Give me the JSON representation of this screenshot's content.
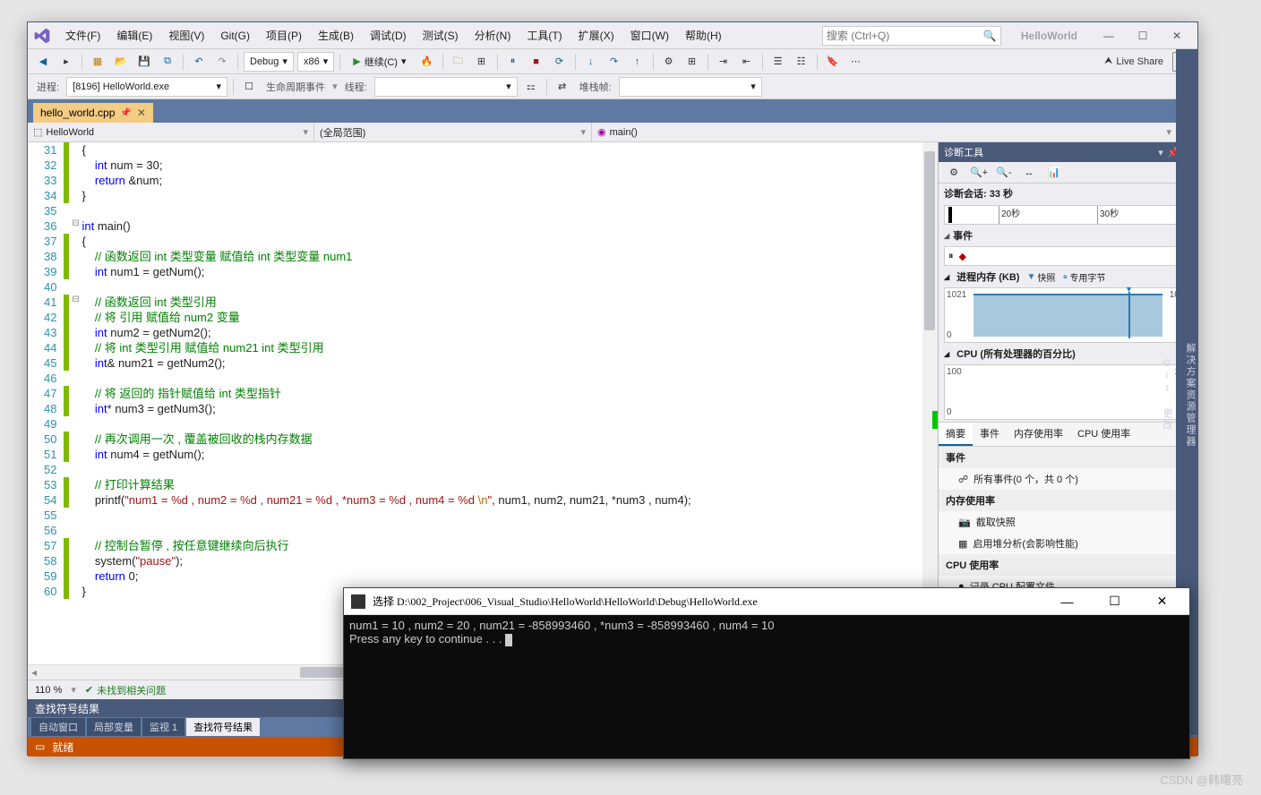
{
  "menu": {
    "items": [
      "文件(F)",
      "编辑(E)",
      "视图(V)",
      "Git(G)",
      "项目(P)",
      "生成(B)",
      "调试(D)",
      "测试(S)",
      "分析(N)",
      "工具(T)",
      "扩展(X)",
      "窗口(W)",
      "帮助(H)"
    ],
    "search_placeholder": "搜索 (Ctrl+Q)",
    "project": "HelloWorld"
  },
  "toolbar1": {
    "config": "Debug",
    "platform": "x86",
    "continue": "继续(C)",
    "live_share": "Live Share"
  },
  "toolbar2": {
    "process_label": "进程:",
    "process": "[8196] HelloWorld.exe",
    "lifecycle": "生命周期事件",
    "thread": "线程:",
    "stackframe": "堆栈帧:"
  },
  "tab": {
    "name": "hello_world.cpp"
  },
  "nav": {
    "project": "HelloWorld",
    "scope": "(全局范围)",
    "func": "main()"
  },
  "code": {
    "start_line": 31,
    "lines": [
      {
        "n": 31,
        "c": true,
        "f": "",
        "t": [
          {
            "c": "",
            "s": "{"
          }
        ]
      },
      {
        "n": 32,
        "c": true,
        "f": "",
        "t": [
          {
            "c": "",
            "s": "    "
          },
          {
            "c": "kw",
            "s": "int"
          },
          {
            "c": "",
            "s": " num = 30;"
          }
        ]
      },
      {
        "n": 33,
        "c": true,
        "f": "",
        "t": [
          {
            "c": "",
            "s": "    "
          },
          {
            "c": "kw",
            "s": "return"
          },
          {
            "c": "",
            "s": " &num;"
          }
        ]
      },
      {
        "n": 34,
        "c": true,
        "f": "",
        "t": [
          {
            "c": "",
            "s": "}"
          }
        ]
      },
      {
        "n": 35,
        "c": false,
        "f": "",
        "t": []
      },
      {
        "n": 36,
        "c": false,
        "f": "⊟",
        "t": [
          {
            "c": "kw",
            "s": "int"
          },
          {
            "c": "",
            "s": " main()"
          }
        ]
      },
      {
        "n": 37,
        "c": true,
        "f": "",
        "t": [
          {
            "c": "",
            "s": "{"
          }
        ]
      },
      {
        "n": 38,
        "c": true,
        "f": "",
        "t": [
          {
            "c": "",
            "s": "    "
          },
          {
            "c": "cm",
            "s": "// 函数返回 int 类型变量 赋值给 int 类型变量 num1"
          }
        ]
      },
      {
        "n": 39,
        "c": true,
        "f": "",
        "t": [
          {
            "c": "",
            "s": "    "
          },
          {
            "c": "kw",
            "s": "int"
          },
          {
            "c": "",
            "s": " num1 = getNum();"
          }
        ]
      },
      {
        "n": 40,
        "c": false,
        "f": "",
        "t": []
      },
      {
        "n": 41,
        "c": true,
        "f": "⊟",
        "t": [
          {
            "c": "",
            "s": "    "
          },
          {
            "c": "cm",
            "s": "// 函数返回 int 类型引用"
          }
        ]
      },
      {
        "n": 42,
        "c": true,
        "f": "",
        "t": [
          {
            "c": "",
            "s": "    "
          },
          {
            "c": "cm",
            "s": "// 将 引用 赋值给 num2 变量"
          }
        ]
      },
      {
        "n": 43,
        "c": true,
        "f": "",
        "t": [
          {
            "c": "",
            "s": "    "
          },
          {
            "c": "kw",
            "s": "int"
          },
          {
            "c": "",
            "s": " num2 = getNum2();"
          }
        ]
      },
      {
        "n": 44,
        "c": true,
        "f": "",
        "t": [
          {
            "c": "",
            "s": "    "
          },
          {
            "c": "cm",
            "s": "// 将 int 类型引用 赋值给 num21 int 类型引用"
          }
        ]
      },
      {
        "n": 45,
        "c": true,
        "f": "",
        "t": [
          {
            "c": "",
            "s": "    "
          },
          {
            "c": "kw",
            "s": "int"
          },
          {
            "c": "",
            "s": "& num21 = getNum2();"
          }
        ]
      },
      {
        "n": 46,
        "c": false,
        "f": "",
        "t": []
      },
      {
        "n": 47,
        "c": true,
        "f": "",
        "t": [
          {
            "c": "",
            "s": "    "
          },
          {
            "c": "cm",
            "s": "// 将 返回的 指针赋值给 int 类型指针"
          }
        ]
      },
      {
        "n": 48,
        "c": true,
        "f": "",
        "t": [
          {
            "c": "",
            "s": "    "
          },
          {
            "c": "kw",
            "s": "int"
          },
          {
            "c": "",
            "s": "* num3 = getNum3();"
          }
        ]
      },
      {
        "n": 49,
        "c": false,
        "f": "",
        "t": []
      },
      {
        "n": 50,
        "c": true,
        "f": "",
        "t": [
          {
            "c": "",
            "s": "    "
          },
          {
            "c": "cm",
            "s": "// 再次调用一次 , 覆盖被回收的栈内存数据"
          }
        ]
      },
      {
        "n": 51,
        "c": true,
        "f": "",
        "t": [
          {
            "c": "",
            "s": "    "
          },
          {
            "c": "kw",
            "s": "int"
          },
          {
            "c": "",
            "s": " num4 = getNum();"
          }
        ]
      },
      {
        "n": 52,
        "c": false,
        "f": "",
        "t": []
      },
      {
        "n": 53,
        "c": true,
        "f": "",
        "t": [
          {
            "c": "",
            "s": "    "
          },
          {
            "c": "cm",
            "s": "// 打印计算结果"
          }
        ]
      },
      {
        "n": 54,
        "c": true,
        "f": "",
        "t": [
          {
            "c": "",
            "s": "    printf("
          },
          {
            "c": "st",
            "s": "\"num1 = %d , num2 = %d , num21 = %d , *num3 = %d , num4 = %d "
          },
          {
            "c": "esc",
            "s": "\\n"
          },
          {
            "c": "st",
            "s": "\""
          },
          {
            "c": "",
            "s": ", num1, num2, num21, *num3 , num4);"
          }
        ]
      },
      {
        "n": 55,
        "c": false,
        "f": "",
        "t": []
      },
      {
        "n": 56,
        "c": false,
        "f": "",
        "t": []
      },
      {
        "n": 57,
        "c": true,
        "f": "",
        "t": [
          {
            "c": "",
            "s": "    "
          },
          {
            "c": "cm",
            "s": "// 控制台暂停 , 按任意键继续向后执行"
          }
        ]
      },
      {
        "n": 58,
        "c": true,
        "f": "",
        "t": [
          {
            "c": "",
            "s": "    system("
          },
          {
            "c": "st",
            "s": "\"pause\""
          },
          {
            "c": "",
            "s": ");"
          }
        ]
      },
      {
        "n": 59,
        "c": true,
        "f": "",
        "t": [
          {
            "c": "",
            "s": "    "
          },
          {
            "c": "kw",
            "s": "return"
          },
          {
            "c": "",
            "s": " 0;"
          }
        ]
      },
      {
        "n": 60,
        "c": true,
        "f": "",
        "t": [
          {
            "c": "",
            "s": "}"
          }
        ]
      }
    ]
  },
  "editor_status": {
    "zoom": "110 %",
    "issues": "未找到相关问题"
  },
  "diag": {
    "title": "诊断工具",
    "session": "诊断会话: 33 秒",
    "timeline": {
      "t1": "20秒",
      "t2": "30秒"
    },
    "events_label": "事件",
    "mem": {
      "label": "进程内存 (KB)",
      "snapshot": "快照",
      "private": "专用字节",
      "ymax": "1021",
      "ymin": "0"
    },
    "cpu": {
      "label": "CPU (所有处理器的百分比)",
      "ymax": "100",
      "ymin": "0"
    },
    "subtabs": [
      "摘要",
      "事件",
      "内存使用率",
      "CPU 使用率"
    ],
    "groups": {
      "events": {
        "h": "事件",
        "item": "所有事件(0 个，共 0 个)"
      },
      "mem": {
        "h": "内存使用率",
        "snap": "截取快照",
        "heap": "启用堆分析(会影响性能)"
      },
      "cpu": {
        "h": "CPU 使用率",
        "rec": "记录 CPU 配置文件"
      }
    }
  },
  "side_rail": [
    "解决方案资源管理器",
    "Git 更改"
  ],
  "results": {
    "title": "查找符号结果"
  },
  "bottom_tabs": [
    "自动窗口",
    "局部变量",
    "监视 1",
    "查找符号结果"
  ],
  "status": {
    "ready": "就绪"
  },
  "console": {
    "title": "选择 D:\\002_Project\\006_Visual_Studio\\HelloWorld\\HelloWorld\\Debug\\HelloWorld.exe",
    "line1": "num1 = 10 , num2 = 20 , num21 = -858993460 , *num3 = -858993460 , num4 = 10",
    "line2": "Press any key to continue . . . "
  },
  "chart_data": [
    {
      "type": "area",
      "title": "进程内存 (KB)",
      "x": [
        0,
        33
      ],
      "y": [
        1021,
        1021
      ],
      "ylim": [
        0,
        1021
      ],
      "xlabel": "秒",
      "ylabel": "KB",
      "series": [
        {
          "name": "专用字节",
          "values": [
            1021,
            1021
          ]
        }
      ],
      "snapshot_at": 26
    },
    {
      "type": "line",
      "title": "CPU (所有处理器的百分比)",
      "x": [
        0,
        33
      ],
      "y": [
        0,
        0
      ],
      "ylim": [
        0,
        100
      ],
      "xlabel": "秒",
      "ylabel": "%"
    }
  ],
  "watermark": "CSDN @韩曙亮"
}
